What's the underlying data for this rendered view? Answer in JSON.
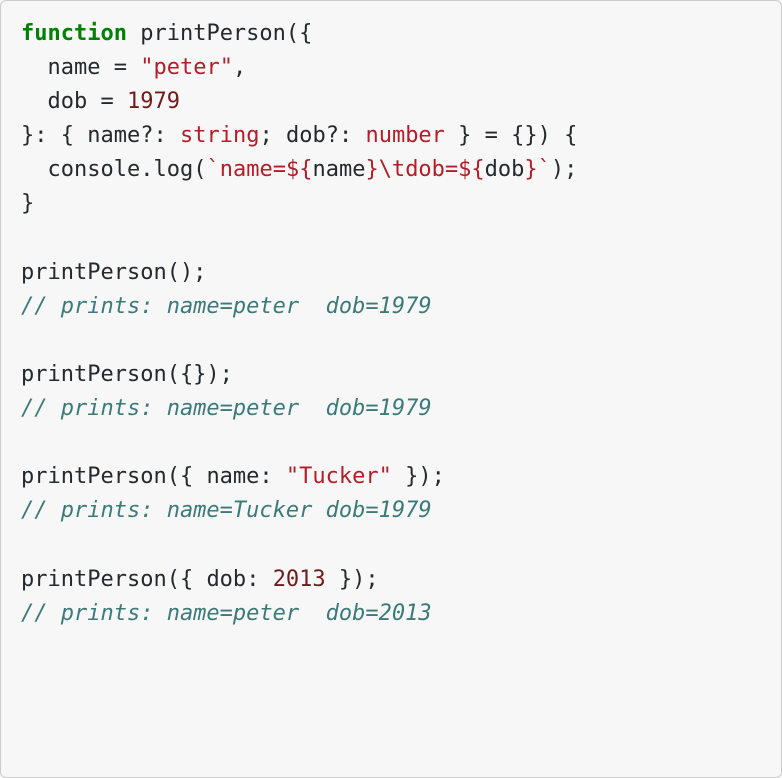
{
  "code": {
    "l1": {
      "kw": "function",
      "sp": " ",
      "fn": "printPerson",
      "p1": "({"
    },
    "l2": {
      "indent": "  ",
      "id": "name",
      "eq": " = ",
      "str": "\"peter\"",
      "comma": ","
    },
    "l3": {
      "indent": "  ",
      "id": "dob",
      "eq": " = ",
      "num": "1979"
    },
    "l4": {
      "p1": "}: { ",
      "k1": "name",
      "q1": "?: ",
      "t1": "string",
      "sep": "; ",
      "k2": "dob",
      "q2": "?: ",
      "t2": "number",
      "p2": " } = {}) {"
    },
    "l5": {
      "indent": "  ",
      "obj": "console",
      "dot": ".",
      "method": "log",
      "open": "(",
      "bt1": "`",
      "s1": "name=",
      "io1": "${",
      "v1": "name",
      "ic1": "}",
      "esc": "\\t",
      "s2": "dob=",
      "io2": "${",
      "v2": "dob",
      "ic2": "}",
      "bt2": "`",
      "close": ");"
    },
    "l6": {
      "brace": "}"
    },
    "l7": {
      "blank": ""
    },
    "l8": {
      "call": "printPerson();"
    },
    "l9": {
      "cmt": "// prints: name=peter  dob=1979"
    },
    "l10": {
      "blank": ""
    },
    "l11": {
      "call": "printPerson({});"
    },
    "l12": {
      "cmt": "// prints: name=peter  dob=1979"
    },
    "l13": {
      "blank": ""
    },
    "l14": {
      "pre": "printPerson({ ",
      "key": "name",
      "colon": ": ",
      "str": "\"Tucker\"",
      "post": " });"
    },
    "l15": {
      "cmt": "// prints: name=Tucker dob=1979"
    },
    "l16": {
      "blank": ""
    },
    "l17": {
      "pre": "printPerson({ ",
      "key": "dob",
      "colon": ": ",
      "num": "2013",
      "post": " });"
    },
    "l18": {
      "cmt": "// prints: name=peter  dob=2013"
    }
  }
}
